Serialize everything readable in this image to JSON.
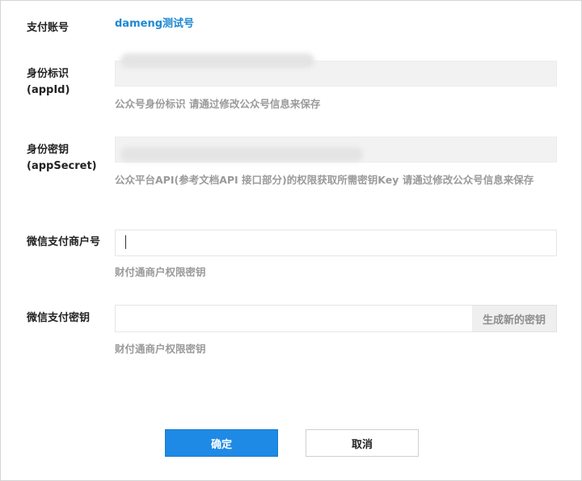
{
  "account": {
    "label": "支付账号",
    "value": "dameng测试号"
  },
  "appid": {
    "label_line1": "身份标识",
    "label_line2": "(appId)",
    "hint": "公众号身份标识 请通过修改公众号信息来保存"
  },
  "appsecret": {
    "label_line1": "身份密钥",
    "label_line2": "(appSecret)",
    "hint": "公众平台API(参考文档API 接口部分)的权限获取所需密钥Key 请通过修改公众号信息来保存"
  },
  "merchant_id": {
    "label": "微信支付商户号",
    "value": "",
    "hint": "财付通商户权限密钥"
  },
  "merchant_key": {
    "label": "微信支付密钥",
    "value": "",
    "generate_label": "生成新的密钥",
    "hint": "财付通商户权限密钥"
  },
  "actions": {
    "confirm_label": "确定",
    "cancel_label": "取消"
  },
  "colors": {
    "link": "#1e88d2",
    "primary": "#1e8ae6",
    "hint": "#9a9a9a"
  }
}
